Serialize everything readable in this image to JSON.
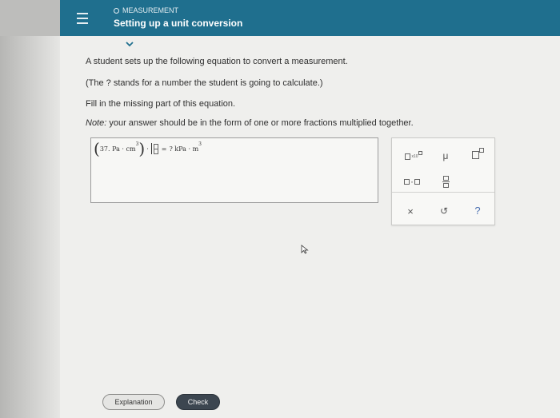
{
  "header": {
    "breadcrumb": "MEASUREMENT",
    "title": "Setting up a unit conversion"
  },
  "question": {
    "line1": "A student sets up the following equation to convert a measurement.",
    "line2": "(The ? stands for a number the student is going to calculate.)",
    "line3": "Fill in the missing part of this equation.",
    "note_label": "Note:",
    "note_text": " your answer should be in the form of one or more fractions multiplied together."
  },
  "equation": {
    "open_paren": "(",
    "lhs": "37. Pa · cm",
    "lhs_exp": "3",
    "close_paren": ")",
    "dot": "·",
    "equals": "=",
    "rhs": "? kPa · m",
    "rhs_exp": "3"
  },
  "keypad": {
    "sci_label": "x10",
    "mu": "μ",
    "times_dot": "·",
    "clear": "×",
    "undo": "↺",
    "help": "?"
  },
  "buttons": {
    "explanation": "Explanation",
    "check": "Check"
  },
  "colors": {
    "header_bg": "#1f6f8e",
    "check_bg": "#3c4650"
  }
}
